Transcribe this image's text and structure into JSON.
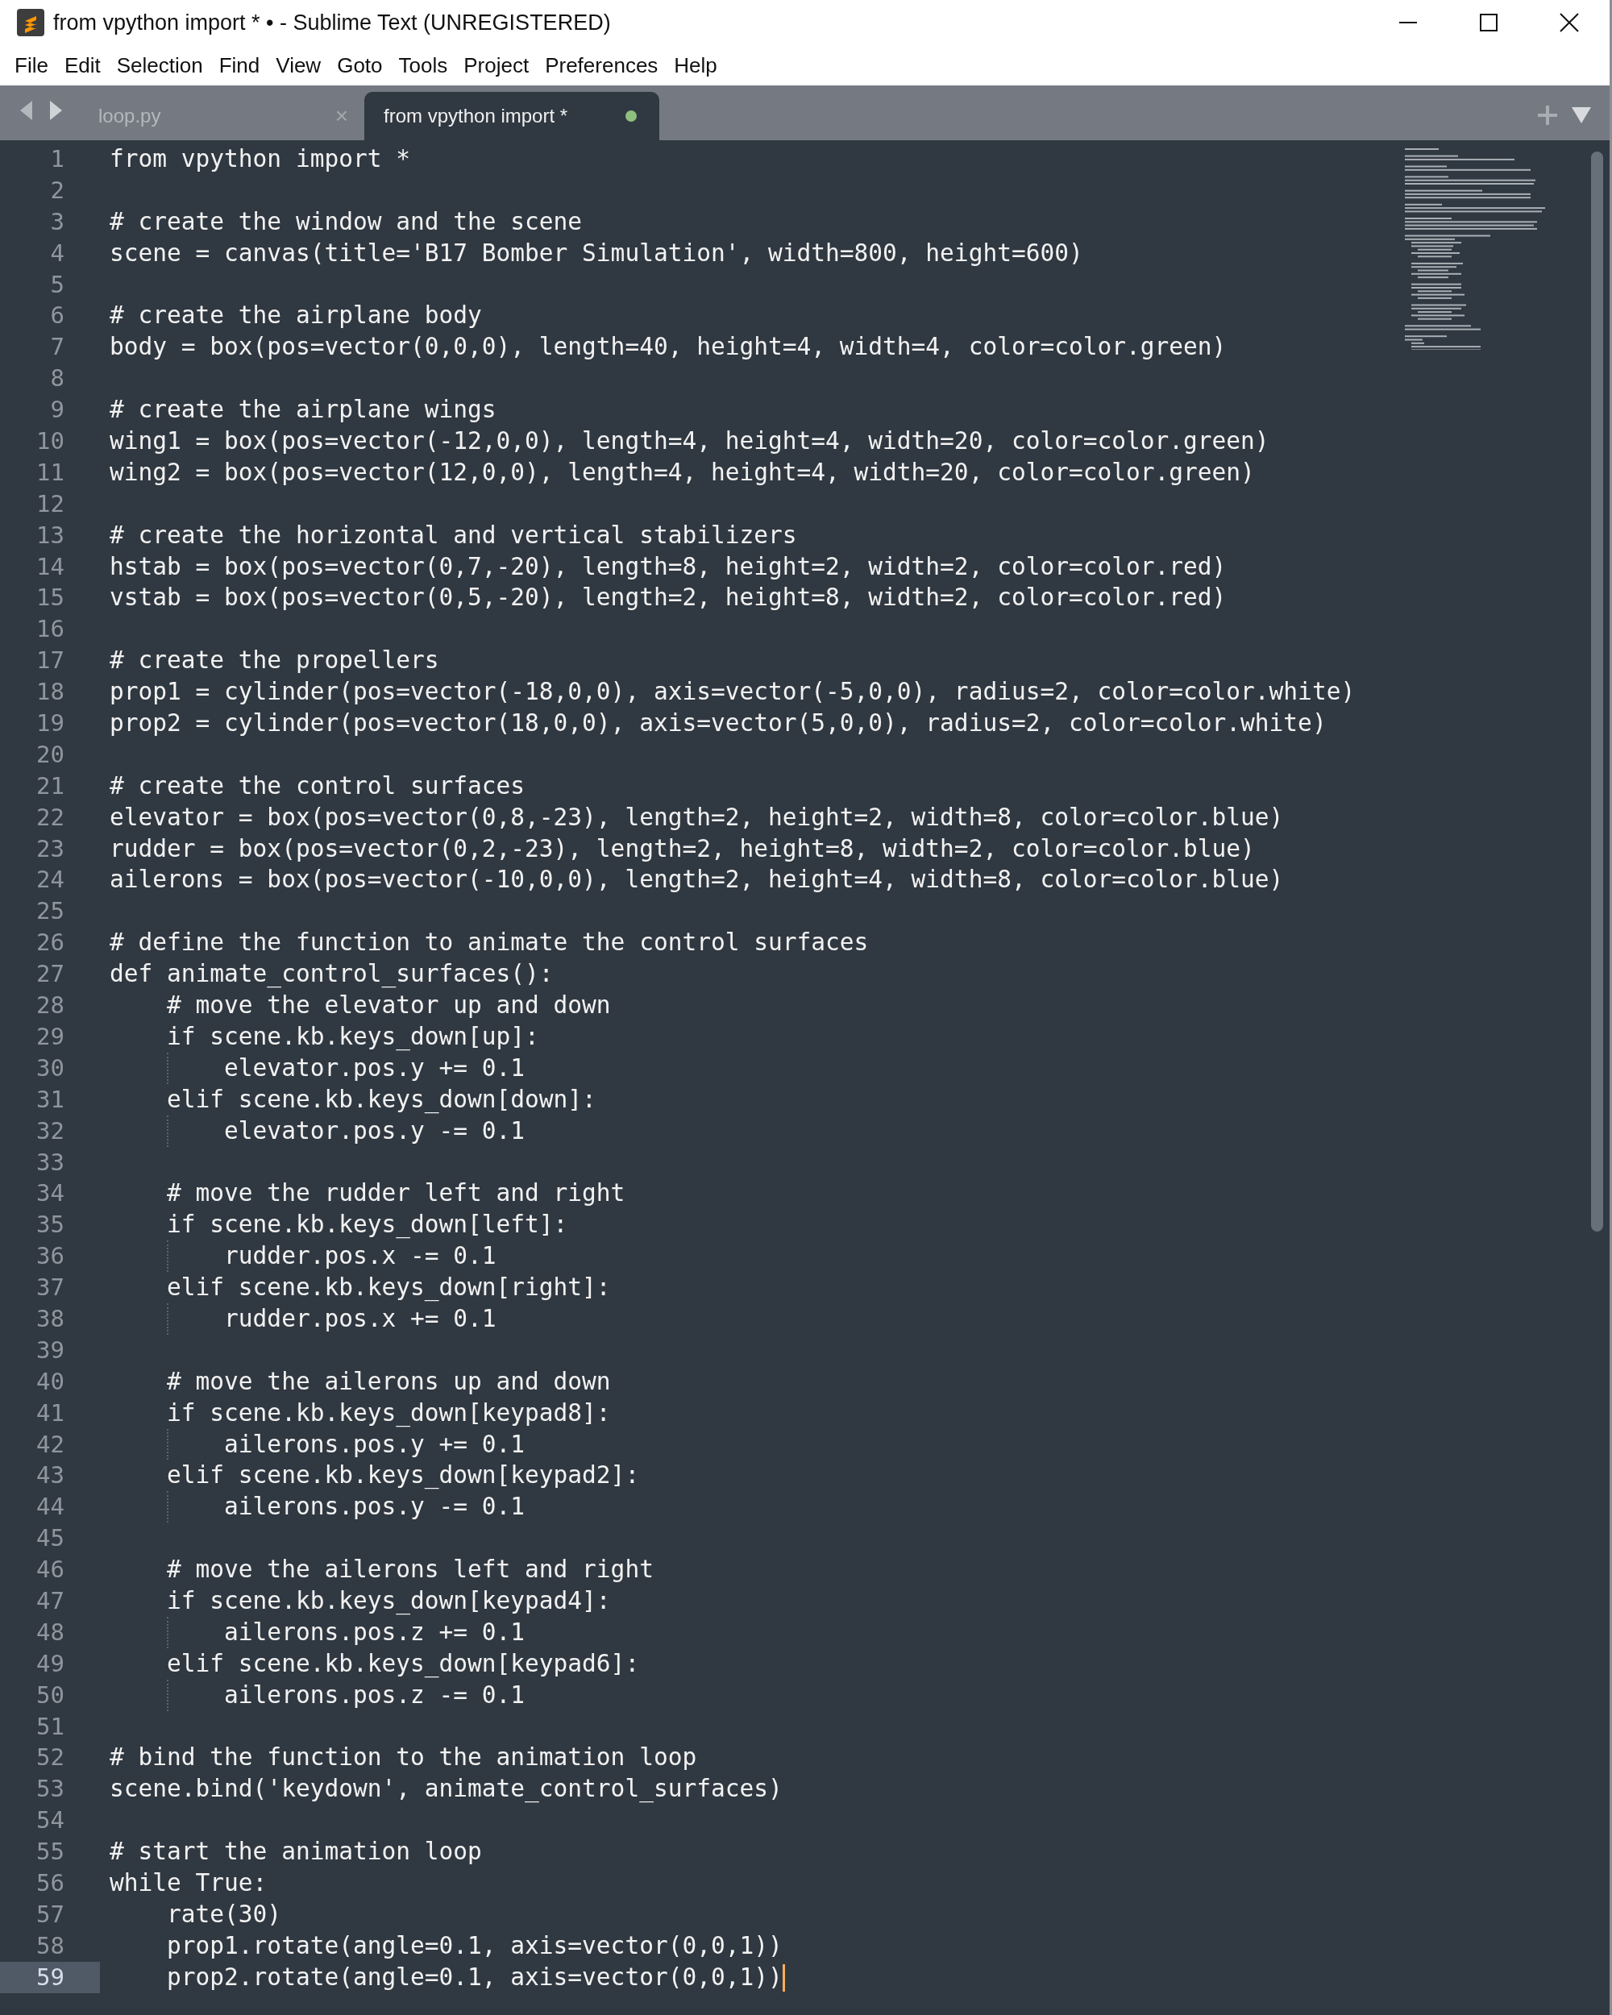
{
  "window": {
    "title": "from vpython import * • - Sublime Text (UNREGISTERED)"
  },
  "menu": [
    "File",
    "Edit",
    "Selection",
    "Find",
    "View",
    "Goto",
    "Tools",
    "Project",
    "Preferences",
    "Help"
  ],
  "tabs": [
    {
      "label": "loop.py",
      "selected": false,
      "modified": false,
      "close": "×"
    },
    {
      "label": "from vpython import *",
      "selected": true,
      "modified": true
    }
  ],
  "editor": {
    "lines": [
      {
        "number": "1",
        "text": "from vpython import *",
        "current": false
      },
      {
        "number": "2",
        "current": false
      },
      {
        "number": "3",
        "text": "# create the window and the scene",
        "current": false
      },
      {
        "number": "4",
        "text": "scene = canvas(title='B17 Bomber Simulation', width=800, height=600)",
        "current": false
      },
      {
        "number": "5",
        "current": false
      },
      {
        "number": "6",
        "text": "# create the airplane body",
        "current": false
      },
      {
        "number": "7",
        "text": "body = box(pos=vector(0,0,0), length=40, height=4, width=4, color=color.green)",
        "current": false
      },
      {
        "number": "8",
        "current": false
      },
      {
        "number": "9",
        "text": "# create the airplane wings",
        "current": false
      },
      {
        "number": "10",
        "text": "wing1 = box(pos=vector(-12,0,0), length=4, height=4, width=20, color=color.green)",
        "current": false
      },
      {
        "number": "11",
        "text": "wing2 = box(pos=vector(12,0,0), length=4, height=4, width=20, color=color.green)",
        "current": false
      },
      {
        "number": "12",
        "current": false
      },
      {
        "number": "13",
        "text": "# create the horizontal and vertical stabilizers",
        "current": false
      },
      {
        "number": "14",
        "text": "hstab = box(pos=vector(0,7,-20), length=8, height=2, width=2, color=color.red)",
        "current": false
      },
      {
        "number": "15",
        "text": "vstab = box(pos=vector(0,5,-20), length=2, height=8, width=2, color=color.red)",
        "current": false
      },
      {
        "number": "16",
        "current": false
      },
      {
        "number": "17",
        "text": "# create the propellers",
        "current": false
      },
      {
        "number": "18",
        "text": "prop1 = cylinder(pos=vector(-18,0,0), axis=vector(-5,0,0), radius=2, color=color.white)",
        "current": false
      },
      {
        "number": "19",
        "text": "prop2 = cylinder(pos=vector(18,0,0), axis=vector(5,0,0), radius=2, color=color.white)",
        "current": false
      },
      {
        "number": "20",
        "current": false
      },
      {
        "number": "21",
        "text": "# create the control surfaces",
        "current": false
      },
      {
        "number": "22",
        "text": "elevator = box(pos=vector(0,8,-23), length=2, height=2, width=8, color=color.blue)",
        "current": false
      },
      {
        "number": "23",
        "text": "rudder = box(pos=vector(0,2,-23), length=2, height=8, width=2, color=color.blue)",
        "current": false
      },
      {
        "number": "24",
        "text": "ailerons = box(pos=vector(-10,0,0), length=2, height=4, width=8, color=color.blue)",
        "current": false
      },
      {
        "number": "25",
        "current": false
      },
      {
        "number": "26",
        "text": "# define the function to animate the control surfaces",
        "current": false
      },
      {
        "number": "27",
        "text": "def animate_control_surfaces():",
        "current": false
      },
      {
        "number": "28",
        "text": "    # move the elevator up and down",
        "current": false
      },
      {
        "number": "29",
        "text": "    if scene.kb.keys_down[up]:",
        "current": false
      },
      {
        "number": "30",
        "text": "        elevator.pos.y += 0.1",
        "current": false
      },
      {
        "number": "31",
        "text": "    elif scene.kb.keys_down[down]:",
        "current": false
      },
      {
        "number": "32",
        "text": "        elevator.pos.y -= 0.1",
        "current": false
      },
      {
        "number": "33",
        "current": false
      },
      {
        "number": "34",
        "text": "    # move the rudder left and right",
        "current": false
      },
      {
        "number": "35",
        "text": "    if scene.kb.keys_down[left]:",
        "current": false
      },
      {
        "number": "36",
        "text": "        rudder.pos.x -= 0.1",
        "current": false
      },
      {
        "number": "37",
        "text": "    elif scene.kb.keys_down[right]:",
        "current": false
      },
      {
        "number": "38",
        "text": "        rudder.pos.x += 0.1",
        "current": false
      },
      {
        "number": "39",
        "current": false
      },
      {
        "number": "40",
        "text": "    # move the ailerons up and down",
        "current": false
      },
      {
        "number": "41",
        "text": "    if scene.kb.keys_down[keypad8]:",
        "current": false
      },
      {
        "number": "42",
        "text": "        ailerons.pos.y += 0.1",
        "current": false
      },
      {
        "number": "43",
        "text": "    elif scene.kb.keys_down[keypad2]:",
        "current": false
      },
      {
        "number": "44",
        "text": "        ailerons.pos.y -= 0.1",
        "current": false
      },
      {
        "number": "45",
        "current": false
      },
      {
        "number": "46",
        "text": "    # move the ailerons left and right",
        "current": false
      },
      {
        "number": "47",
        "text": "    if scene.kb.keys_down[keypad4]:",
        "current": false
      },
      {
        "number": "48",
        "text": "        ailerons.pos.z += 0.1",
        "current": false
      },
      {
        "number": "49",
        "text": "    elif scene.kb.keys_down[keypad6]:",
        "current": false
      },
      {
        "number": "50",
        "text": "        ailerons.pos.z -= 0.1",
        "current": false
      },
      {
        "number": "51",
        "current": false
      },
      {
        "number": "52",
        "text": "# bind the function to the animation loop",
        "current": false
      },
      {
        "number": "53",
        "text": "scene.bind('keydown', animate_control_surfaces)",
        "current": false
      },
      {
        "number": "54",
        "current": false
      },
      {
        "number": "55",
        "text": "# start the animation loop",
        "current": false
      },
      {
        "number": "56",
        "text": "while True:",
        "current": false
      },
      {
        "number": "57",
        "text": "    rate(30)",
        "current": false
      },
      {
        "number": "58",
        "text": "    prop1.rotate(angle=0.1, axis=vector(0,0,1))",
        "current": false
      },
      {
        "number": "59",
        "text": "    prop2.rotate(angle=0.1, axis=vector(0,0,1))",
        "current": true
      }
    ]
  }
}
